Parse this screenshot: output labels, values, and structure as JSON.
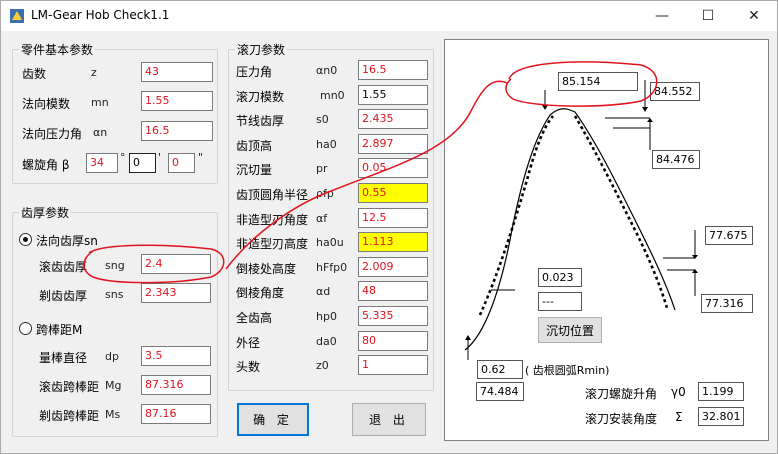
{
  "window": {
    "title": "LM-Gear Hob Check1.1",
    "minimize": "—",
    "maximize": "☐",
    "close": "✕"
  },
  "part": {
    "title": "零件基本参数",
    "fields": [
      {
        "label": "齿数",
        "symbol": "z",
        "value": "43"
      },
      {
        "label": "法向模数",
        "symbol": "mn",
        "value": "1.55"
      },
      {
        "label": "法向压力角",
        "symbol": "αn",
        "value": "16.5"
      }
    ],
    "helix": {
      "label": "螺旋角 β",
      "deg": "34",
      "deg_unit": "°",
      "min": "0",
      "min_unit": "'",
      "sec": "0",
      "sec_unit": "\""
    }
  },
  "thickness": {
    "title": "齿厚参数",
    "radio1": "法向齿厚sn",
    "f1": {
      "label": "滚齿齿厚",
      "symbol": "sng",
      "value": "2.4"
    },
    "f2": {
      "label": "剃齿齿厚",
      "symbol": "sns",
      "value": "2.343"
    },
    "radio2": "跨棒距M",
    "f3": {
      "label": "量棒直径",
      "symbol": "dp",
      "value": "3.5"
    },
    "f4": {
      "label": "滚齿跨棒距",
      "symbol": "Mg",
      "value": "87.316"
    },
    "f5": {
      "label": "剃齿跨棒距",
      "symbol": "Ms",
      "value": "87.16"
    }
  },
  "hob": {
    "title": "滚刀参数",
    "fields": [
      {
        "label": "压力角",
        "symbol": "αn0",
        "value": "16.5"
      },
      {
        "label": "滚刀模数",
        "symbol": "mn0",
        "value": "1.55"
      },
      {
        "label": "节线齿厚",
        "symbol": "s0",
        "value": "2.435"
      },
      {
        "label": "齿顶高",
        "symbol": "ha0",
        "value": "2.897"
      },
      {
        "label": "沉切量",
        "symbol": "pr",
        "value": "0.05"
      },
      {
        "label": "齿顶圆角半径",
        "symbol": "ρfp",
        "value": "0.55"
      },
      {
        "label": "非造型刃角度",
        "symbol": "αf",
        "value": "12.5"
      },
      {
        "label": "非造型刃高度",
        "symbol": "ha0u",
        "value": "1.113"
      },
      {
        "label": "倒棱处高度",
        "symbol": "hFfp0",
        "value": "2.009"
      },
      {
        "label": "倒棱角度",
        "symbol": "αd",
        "value": "48"
      },
      {
        "label": "全齿高",
        "symbol": "hp0",
        "value": "5.335"
      },
      {
        "label": "外径",
        "symbol": "da0",
        "value": "80"
      },
      {
        "label": "头数",
        "symbol": "z0",
        "value": "1"
      }
    ]
  },
  "buttons": {
    "ok": "确 定",
    "exit": "退 出",
    "undercut": "沉切位置"
  },
  "diagram": {
    "v1": "85.154",
    "v2": "84.552",
    "v3": "84.476",
    "v4": "77.675",
    "v5": "77.316",
    "v6": "0.023",
    "v7": "---",
    "v8": "0.62",
    "v9": "74.484",
    "rmin_label": "( 齿根圆弧Rmin)",
    "lead_label": "滚刀螺旋升角",
    "lead_sym": "γ0",
    "lead_val": "1.199",
    "install_label": "滚刀安装角度",
    "install_sym": "Σ",
    "install_val": "32.801"
  },
  "colors": {
    "value_red": "#e0141e",
    "highlight": "#ffff00",
    "annotation": "#e0141e",
    "focus_blue": "#0078d7"
  }
}
